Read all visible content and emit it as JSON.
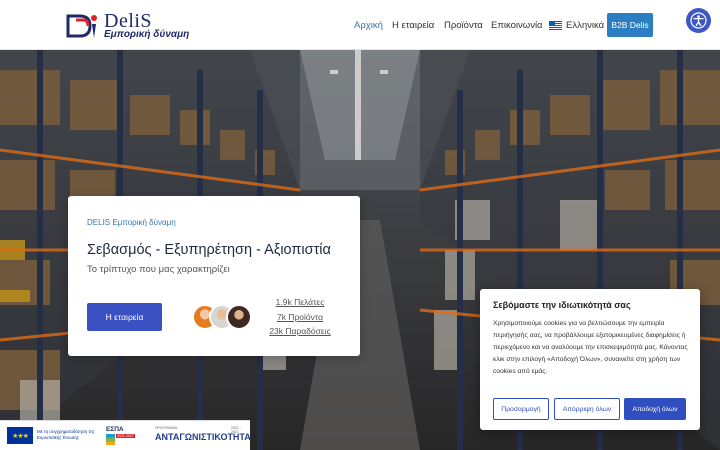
{
  "header": {
    "logo": {
      "name": "DeliS",
      "tagline": "Εμπορική δύναμη"
    },
    "nav": [
      {
        "label": "Αρχική",
        "active": true
      },
      {
        "label": "Η εταιρεία",
        "active": false
      },
      {
        "label": "Προϊόντα",
        "active": false
      },
      {
        "label": "Επικοινωνία",
        "active": false
      }
    ],
    "language": {
      "label": "Ελληνικά",
      "icon": "greek-flag-icon"
    },
    "b2b_label": "B2B Delis",
    "accessibility_icon": "accessibility-icon"
  },
  "hero": {
    "eyebrow": "DELIS Εμπορική δύναμη",
    "title": "Σεβασμός - Εξυπηρέτηση - Αξιοπιστία",
    "subtitle": "Το τρίπτυχο που μας χαρακτηρίζει",
    "cta_label": "Η εταιρεία",
    "stats": [
      "1.9k Πελάτες",
      "7k Προϊόντα",
      "23k Παραδόσεις"
    ]
  },
  "cookie": {
    "title": "Σεβόμαστε την ιδιωτικότητά σας",
    "text": "Χρησιμοποιούμε cookies για να βελτιώσουμε την εμπειρία περιήγησής σας, να προβάλλουμε εξατομικευμένες διαφημίσεις ή περιεχόμενο και να αναλύουμε την επισκεψιμότητά μας. Κάνοντας κλικ στην επιλογή «Αποδοχή Όλων», συναινείτε στη χρήση των cookies από εμάς.",
    "buttons": {
      "customize": "Προσαρμογή",
      "reject": "Απόρριψη όλων",
      "accept": "Αποδοχή όλων"
    }
  },
  "eu_banner": {
    "eu_text": "Με τη συγχρηματοδότηση της Ευρωπαϊκής Ένωσης",
    "espa": "ΕΣΠΑ",
    "espa_years": "2021-2027",
    "program_small": "ΠΡΟΓΡΑΜΜΑ",
    "program_years": "2021 - 2027",
    "program": "ΑΝΤΑΓΩΝΙΣΤΙΚΟΤΗΤΑ"
  },
  "colors": {
    "primary": "#3a50c3",
    "link": "#2f78b5",
    "logo": "#1f2a6b",
    "logo_accent": "#e2202a"
  }
}
